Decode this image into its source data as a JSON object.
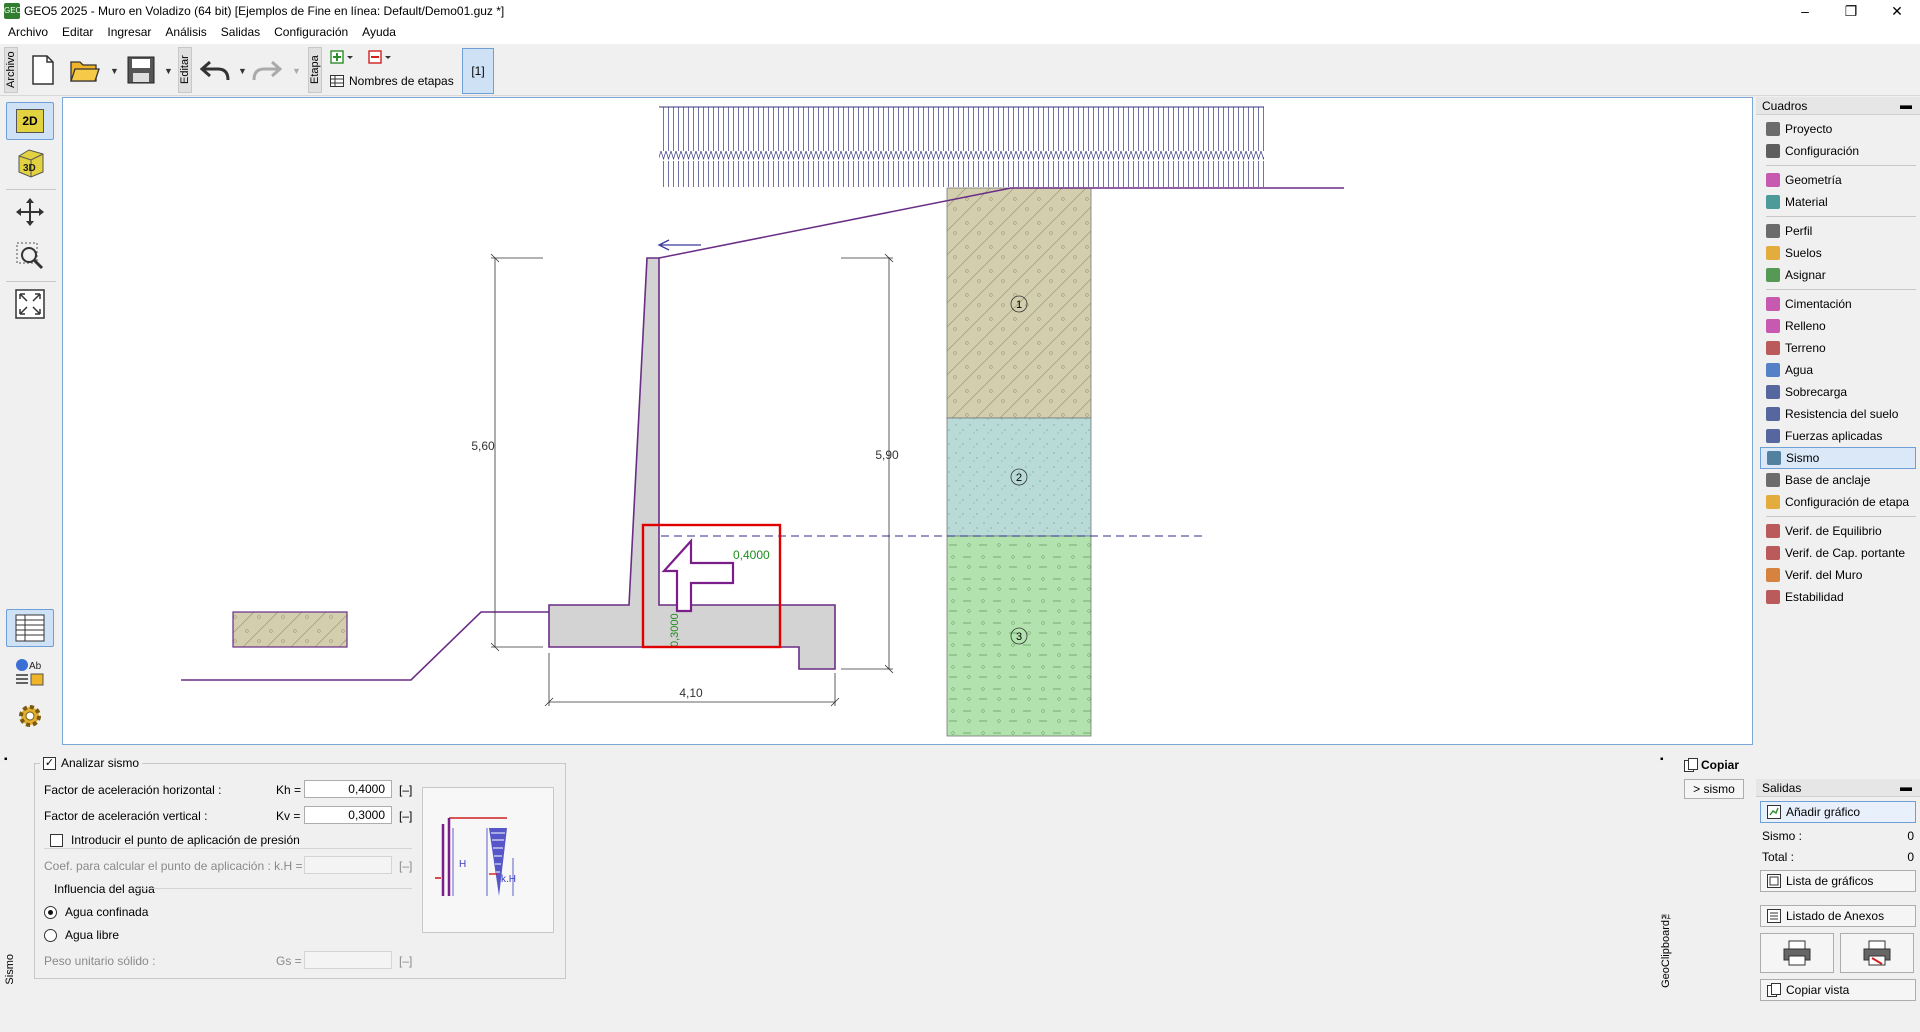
{
  "window": {
    "title": "GEO5 2025 - Muro en Voladizo (64 bit) [Ejemplos de Fine en línea: Default/Demo01.guz *]",
    "logo_text": "GEO5",
    "controls": {
      "minimize": "–",
      "maximize": "❐",
      "close": "✕"
    }
  },
  "menu": [
    "Archivo",
    "Editar",
    "Ingresar",
    "Análisis",
    "Salidas",
    "Configuración",
    "Ayuda"
  ],
  "toolbar": {
    "archivo_label": "Archivo",
    "editar_label": "Editar",
    "etapa_label": "Etapa",
    "stage_names_label": "Nombres de etapas",
    "stage_button": "[1]"
  },
  "left_tools": {
    "btn_2d": "2D",
    "btn_3d": "3D"
  },
  "drawing": {
    "dim_wall_height": "5,60",
    "dim_right_height": "5,90",
    "dim_base_width": "4,10",
    "kh_label": "0,4000",
    "kv_label": "0,3000",
    "soil_numbers": [
      "1",
      "2",
      "3"
    ],
    "colors": {
      "outline": "#6a2d85",
      "wall_fill": "#d3d3d3",
      "soil1": "#d2ceae",
      "soil2": "#b9dbd8",
      "soil3": "#b2e3ae",
      "highlight": "#e00000",
      "surcharge": "#34357f",
      "water": "#2f2f8f",
      "kh_text": "#1e8c1e"
    }
  },
  "right_panel": {
    "frames_title": "Cuadros",
    "items": [
      {
        "label": "Proyecto",
        "icon": "document-icon",
        "color": "#555555"
      },
      {
        "label": "Configuración",
        "icon": "gear-icon",
        "color": "#444444"
      },
      {
        "label": "Geometría",
        "icon": "wall-geometry-icon",
        "color": "#c03fa4"
      },
      {
        "label": "Material",
        "icon": "material-icon",
        "color": "#2f8b8b"
      },
      {
        "label": "Perfil",
        "icon": "profile-icon",
        "color": "#555555"
      },
      {
        "label": "Suelos",
        "icon": "soil-icon",
        "color": "#e0a020"
      },
      {
        "label": "Asignar",
        "icon": "assign-icon",
        "color": "#3a8a3a"
      },
      {
        "label": "Cimentación",
        "icon": "foundation-icon",
        "color": "#c03fa4"
      },
      {
        "label": "Relleno",
        "icon": "backfill-icon",
        "color": "#c03fa4"
      },
      {
        "label": "Terreno",
        "icon": "terrain-icon",
        "color": "#b04040"
      },
      {
        "label": "Agua",
        "icon": "water-icon",
        "color": "#3a6fbf"
      },
      {
        "label": "Sobrecarga",
        "icon": "surcharge-icon",
        "color": "#3a4f8f"
      },
      {
        "label": "Resistencia del suelo",
        "icon": "resistance-icon",
        "color": "#3a4f8f"
      },
      {
        "label": "Fuerzas aplicadas",
        "icon": "force-icon",
        "color": "#3a4f8f"
      },
      {
        "label": "Sismo",
        "icon": "earthquake-icon",
        "color": "#3a6f8f"
      },
      {
        "label": "Base de anclaje",
        "icon": "anchor-icon",
        "color": "#555555"
      },
      {
        "label": "Configuración de etapa",
        "icon": "stage-settings-icon",
        "color": "#e0a020"
      },
      {
        "label": "Verif. de Equilibrio",
        "icon": "equilibrium-icon",
        "color": "#b04040"
      },
      {
        "label": "Verif. de Cap. portante",
        "icon": "bearing-icon",
        "color": "#b04040"
      },
      {
        "label": "Verif. del Muro",
        "icon": "wall-check-icon",
        "color": "#d07020"
      },
      {
        "label": "Estabilidad",
        "icon": "stability-icon",
        "color": "#b04040"
      }
    ],
    "active_item": "Sismo",
    "outputs_title": "Salidas",
    "add_chart": "Añadir gráfico",
    "sismo_label": "Sismo :",
    "sismo_count": "0",
    "total_label": "Total :",
    "total_count": "0",
    "list_charts": "Lista de gráficos",
    "list_annexes": "Listado de Anexos",
    "copy_view": "Copiar vista"
  },
  "bottom": {
    "side_label": "Sismo",
    "analyze_label": "Analizar sismo",
    "analyze_checked": true,
    "kh_label": "Factor de aceleración horizontal  :",
    "kh_symbol": "Kh =",
    "kh_value": "0,4000",
    "kv_label": "Factor de aceleración vertical :",
    "kv_symbol": "Kv =",
    "kv_value": "0,3000",
    "unit": "[–]",
    "point_label": "Introducir el punto de aplicación de presión",
    "coef_label": "Coef. para calcular el punto de aplicación : k.H =",
    "water_group": "Influencia del agua",
    "confined_label": "Agua confinada",
    "free_label": "Agua libre",
    "unit_weight_label": "Peso unitario sólido :",
    "gs_symbol": "Gs =",
    "diagram_h": "H",
    "diagram_kh": "k.H",
    "copy_label": "Copiar",
    "sismo_btn": "> sismo",
    "geoclipboard": "GeoClipboard™"
  }
}
